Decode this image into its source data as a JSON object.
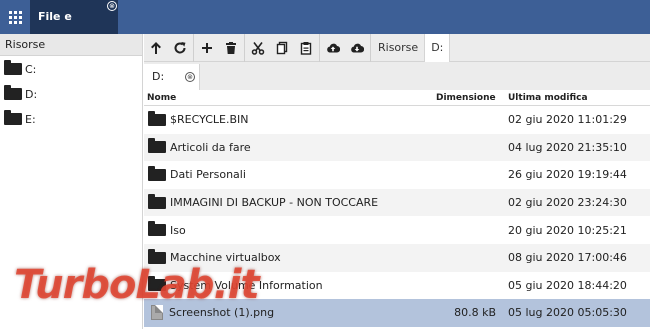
{
  "app": {
    "tab_label": "File e Cartelle",
    "tab_close": "⊗"
  },
  "sidebar": {
    "title": "Risorse",
    "drives": [
      {
        "label": "C:"
      },
      {
        "label": "D:"
      },
      {
        "label": "E:"
      }
    ]
  },
  "toolbar": {
    "icons": [
      "up-arrow-icon",
      "refresh-icon",
      "plus-icon",
      "trash-icon",
      "scissors-icon",
      "copy-icon",
      "paste-icon",
      "upload-icon",
      "download-icon"
    ],
    "breadcrumb": [
      "Risorse",
      "D:"
    ]
  },
  "path_tab": {
    "label": "D:",
    "close": "⊗"
  },
  "list": {
    "headers": {
      "name": "Nome",
      "size": "Dimensione",
      "modified": "Ultima modifica"
    },
    "rows": [
      {
        "type": "folder",
        "name": "$RECYCLE.BIN",
        "size": "",
        "modified": "02 giu 2020 11:01:29"
      },
      {
        "type": "folder",
        "name": "Articoli da fare",
        "size": "",
        "modified": "04 lug 2020 21:35:10"
      },
      {
        "type": "folder",
        "name": "Dati Personali",
        "size": "",
        "modified": "26 giu 2020 19:19:44"
      },
      {
        "type": "folder",
        "name": "IMMAGINI DI BACKUP - NON TOCCARE",
        "size": "",
        "modified": "02 giu 2020 23:24:30"
      },
      {
        "type": "folder",
        "name": "Iso",
        "size": "",
        "modified": "20 giu 2020 10:25:21"
      },
      {
        "type": "folder",
        "name": "Macchine virtualbox",
        "size": "",
        "modified": "08 giu 2020 17:00:46"
      },
      {
        "type": "folder",
        "name": "System Volume Information",
        "size": "",
        "modified": "05 giu 2020 18:44:20"
      },
      {
        "type": "file",
        "name": "Screenshot (1).png",
        "size": "80.8 kB",
        "modified": "05 lug 2020 05:05:30",
        "selected": true
      }
    ]
  },
  "watermark": "TurboLab.it",
  "colors": {
    "topbar": "#3d5f96",
    "active_tab": "#1f3558",
    "selected_row": "#b3c3dc",
    "watermark": "#e04632"
  }
}
